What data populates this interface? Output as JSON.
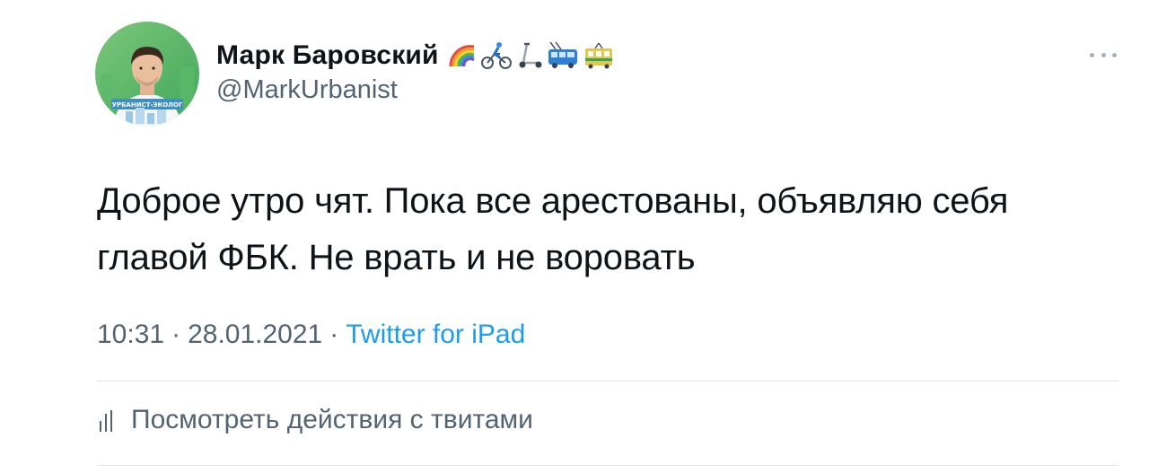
{
  "author": {
    "display_name": "Марк Баровский",
    "username": "@MarkUrbanist",
    "avatar_badge": "УРБАНИСТ-ЭКОЛОГ",
    "name_emojis": [
      "rainbow-icon",
      "cyclist-icon",
      "kick-scooter-icon",
      "trolleybus-icon",
      "tram-icon"
    ]
  },
  "tweet": {
    "text": "Доброе утро чят. Пока все арестованы, объявляю себя главой ФБК. Не врать и не воровать",
    "time": "10:31",
    "date": "28.01.2021",
    "separator": "·",
    "source": "Twitter for iPad"
  },
  "actions": {
    "activity_label": "Посмотреть действия с твитами"
  },
  "colors": {
    "text": "#0f1419",
    "secondary": "#536471",
    "link": "#1d9bf0",
    "divider": "#dfe3e7"
  }
}
